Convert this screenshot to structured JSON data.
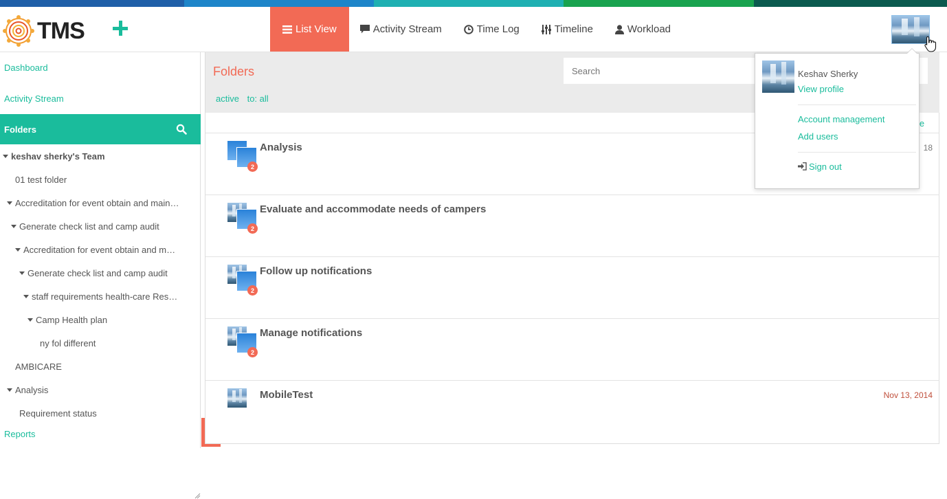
{
  "colors": {
    "accent": "#1abc9c",
    "active": "#f26a55",
    "stripe": [
      "#1f5fa8",
      "#1d85c9",
      "#1fb0b2",
      "#19a34f",
      "#0b5a4f"
    ]
  },
  "app": {
    "logo_text": "TMS",
    "add_icon": "plus-icon"
  },
  "nav": {
    "items": [
      {
        "label": "List View",
        "icon": "list-icon"
      },
      {
        "label": "Activity Stream",
        "icon": "comment-icon"
      },
      {
        "label": "Time Log",
        "icon": "clock-icon"
      },
      {
        "label": "Timeline",
        "icon": "sliders-icon"
      },
      {
        "label": "Workload",
        "icon": "user-icon"
      }
    ]
  },
  "sidebar": {
    "dashboard": "Dashboard",
    "activity_stream": "Activity Stream",
    "folders": "Folders",
    "reports": "Reports",
    "tree": [
      {
        "label": "keshav sherky's Team"
      },
      {
        "label": "01 test folder"
      },
      {
        "label": "Accreditation for event obtain and maintain"
      },
      {
        "label": "Generate check list and camp audit"
      },
      {
        "label": "Accreditation for event obtain and maintain"
      },
      {
        "label": "Generate check list and camp audit"
      },
      {
        "label": "staff requirements health-care Resources"
      },
      {
        "label": "Camp Health plan"
      },
      {
        "label": "ny fol different"
      },
      {
        "label": "AMBICARE"
      },
      {
        "label": "Analysis"
      },
      {
        "label": "Requirement status"
      }
    ]
  },
  "main": {
    "title": "Folders",
    "search_placeholder": "Search",
    "filters": [
      "active",
      "to: all"
    ],
    "sort_label": "le",
    "rows": [
      {
        "title": "Analysis",
        "count": "2",
        "date": "18"
      },
      {
        "title": "Evaluate and accommodate needs of campers",
        "count": "2",
        "date": ""
      },
      {
        "title": "Follow up notifications",
        "count": "2",
        "date": ""
      },
      {
        "title": "Manage notifications",
        "count": "2",
        "date": ""
      },
      {
        "title": "MobileTest",
        "count": "",
        "date": "Nov 13, 2014"
      }
    ]
  },
  "profile_menu": {
    "name": "Keshav Sherky",
    "view_profile": "View profile",
    "account_management": "Account management",
    "add_users": "Add users",
    "sign_out": "Sign out"
  }
}
